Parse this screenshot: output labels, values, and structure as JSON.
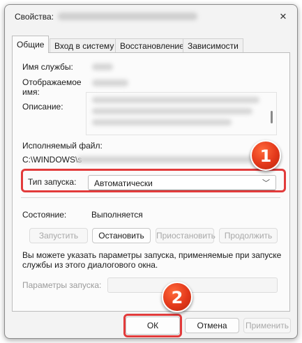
{
  "window": {
    "title": "Свойства:",
    "close_label": "✕"
  },
  "tabs": [
    {
      "label": "Общие"
    },
    {
      "label": "Вход в систему"
    },
    {
      "label": "Восстановление"
    },
    {
      "label": "Зависимости"
    }
  ],
  "general": {
    "service_name_label": "Имя службы:",
    "display_name_label_1": "Отображаемое",
    "display_name_label_2": "имя:",
    "description_label": "Описание:",
    "executable_label": "Исполняемый файл:",
    "executable_path": "C:\\WINDOWS\\s",
    "startup_type_label": "Тип запуска:",
    "startup_type_value": "Автоматически",
    "status_label": "Состояние:",
    "status_value": "Выполняется",
    "start_button": "Запустить",
    "stop_button": "Остановить",
    "pause_button": "Приостановить",
    "resume_button": "Продолжить",
    "hint_line_1": "Вы можете указать параметры запуска, применяемые при запуске",
    "hint_line_2": "службы из этого диалогового окна.",
    "start_params_label": "Параметры запуска:"
  },
  "footer": {
    "ok_button": "ОК",
    "cancel_button": "Отмена",
    "apply_button": "Применить"
  },
  "annotations": {
    "marker_1": "1",
    "marker_2": "2"
  },
  "colors": {
    "highlight": "#e23b3b",
    "marker": "#e3381a"
  }
}
